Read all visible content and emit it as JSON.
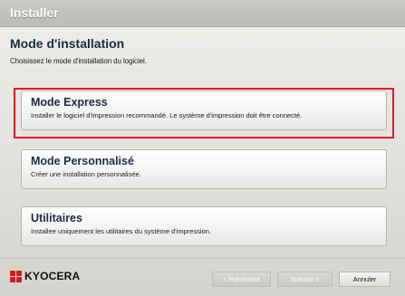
{
  "window": {
    "title": "Installer"
  },
  "section": {
    "title": "Mode d'installation",
    "subtitle": "Choisissez le mode d'installation du logiciel."
  },
  "options": [
    {
      "label": "Mode Express",
      "description": "Installer le logiciel d'impression recommandé. Le système d'impression doit être connecté.",
      "highlighted": true
    },
    {
      "label": "Mode Personnalisé",
      "description": "Créer une installation personnalisée."
    },
    {
      "label": "Utilitaires",
      "description": "Installee uniquement les utilitaires du système d'impression."
    }
  ],
  "brand": {
    "name": "KYOCERA",
    "color": "#d8161c"
  },
  "buttons": {
    "prev": "< Précédent",
    "next": "Suivant >",
    "cancel": "Annuler"
  },
  "colors": {
    "highlight_border": "#e01e1e",
    "heading": "#1f2a44"
  }
}
